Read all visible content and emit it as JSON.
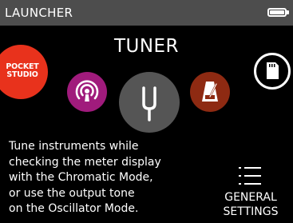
{
  "status_bar": {
    "title": "LAUNCHER",
    "battery_icon": "battery-icon"
  },
  "main": {
    "app_title": "TUNER",
    "apps": [
      {
        "name": "pocket-studio",
        "label_line1": "POCKET",
        "label_line2": "STUDIO",
        "color": "#e8321c"
      },
      {
        "name": "podcast",
        "icon": "podcast-icon",
        "color": "#a01b7c"
      },
      {
        "name": "tuner",
        "icon": "tuning-fork-icon",
        "color": "#555555"
      },
      {
        "name": "metronome",
        "icon": "metronome-icon",
        "color": "#8e2a12"
      },
      {
        "name": "sd-card",
        "icon": "sd-card-icon",
        "color": "#000000"
      }
    ],
    "description": [
      "Tune instruments while",
      "checking the meter display",
      "with the Chromatic Mode,",
      "or use the output tone",
      "on the Oscillator Mode."
    ]
  },
  "settings": {
    "icon": "menu-list-icon",
    "label_line1": "GENERAL",
    "label_line2": "SETTINGS"
  }
}
